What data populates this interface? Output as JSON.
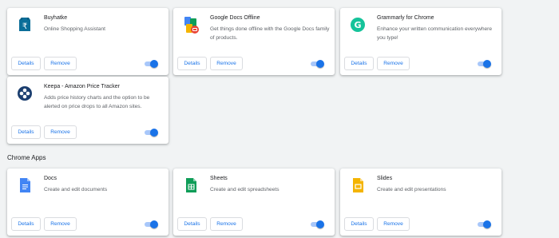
{
  "extensions": [
    {
      "name": "Buyhatke",
      "description": "Online Shopping Assistant",
      "details_label": "Details",
      "remove_label": "Remove",
      "icon": "buyhatke-icon",
      "enabled": true
    },
    {
      "name": "Google Docs Offline",
      "description": "Get things done offline with the Google Docs family of products.",
      "details_label": "Details",
      "remove_label": "Remove",
      "icon": "google-docs-offline-icon",
      "enabled": true
    },
    {
      "name": "Grammarly for Chrome",
      "description": "Enhance your written communication everywhere you type!",
      "details_label": "Details",
      "remove_label": "Remove",
      "icon": "grammarly-icon",
      "enabled": true
    },
    {
      "name": "Keepa - Amazon Price Tracker",
      "description": "Adds price history charts and the option to be alerted on price drops to all Amazon sites.",
      "details_label": "Details",
      "remove_label": "Remove",
      "icon": "keepa-icon",
      "enabled": true
    }
  ],
  "chrome_apps": {
    "title": "Chrome Apps",
    "items": [
      {
        "name": "Docs",
        "description": "Create and edit documents",
        "details_label": "Details",
        "remove_label": "Remove",
        "icon": "docs-icon",
        "enabled": true
      },
      {
        "name": "Sheets",
        "description": "Create and edit spreadsheets",
        "details_label": "Details",
        "remove_label": "Remove",
        "icon": "sheets-icon",
        "enabled": true
      },
      {
        "name": "Slides",
        "description": "Create and edit presentations",
        "details_label": "Details",
        "remove_label": "Remove",
        "icon": "slides-icon",
        "enabled": true
      }
    ]
  },
  "colors": {
    "accent": "#1a73e8",
    "background": "#f1f3f4",
    "docs": "#4285f4",
    "sheets": "#0f9d58",
    "slides": "#f4b400",
    "grammarly": "#15c39a",
    "keepa": "#1b3e6f",
    "buyhatke": "#0b6e99"
  }
}
